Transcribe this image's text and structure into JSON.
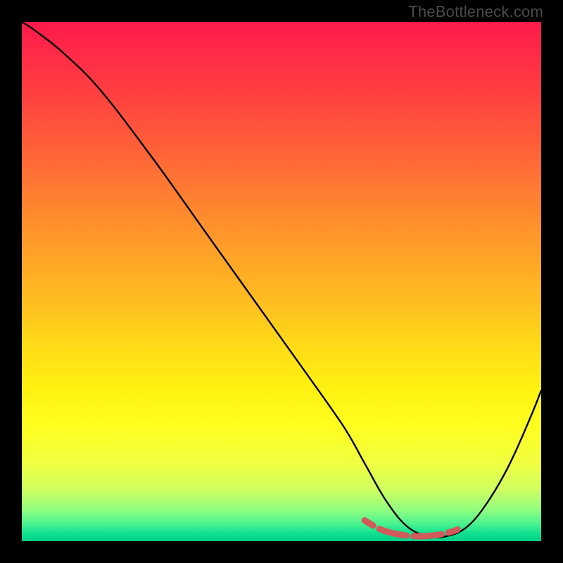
{
  "watermark": "TheBottleneck.com",
  "chart_data": {
    "type": "line",
    "title": "",
    "xlabel": "",
    "ylabel": "",
    "xlim": [
      0,
      100
    ],
    "ylim": [
      0,
      100
    ],
    "series": [
      {
        "name": "curve",
        "x": [
          0,
          3,
          8,
          15,
          25,
          35,
          45,
          55,
          62,
          66,
          70,
          74,
          78,
          82,
          86,
          90,
          94,
          98,
          100
        ],
        "values": [
          100,
          98,
          94,
          87,
          74,
          60,
          46,
          32,
          22,
          15,
          8,
          3,
          1,
          1,
          3,
          8,
          15,
          24,
          29
        ]
      }
    ],
    "markers": {
      "name": "optimal-band",
      "x": [
        66,
        69,
        72,
        75,
        78,
        81,
        84,
        86
      ],
      "values": [
        4,
        2.3,
        1.4,
        1.0,
        1.0,
        1.4,
        2.3,
        4
      ]
    },
    "gradient_stops": [
      {
        "pct": 0,
        "color": "#ff1a4a"
      },
      {
        "pct": 50,
        "color": "#ffc020"
      },
      {
        "pct": 80,
        "color": "#ffff20"
      },
      {
        "pct": 100,
        "color": "#00d088"
      }
    ]
  }
}
